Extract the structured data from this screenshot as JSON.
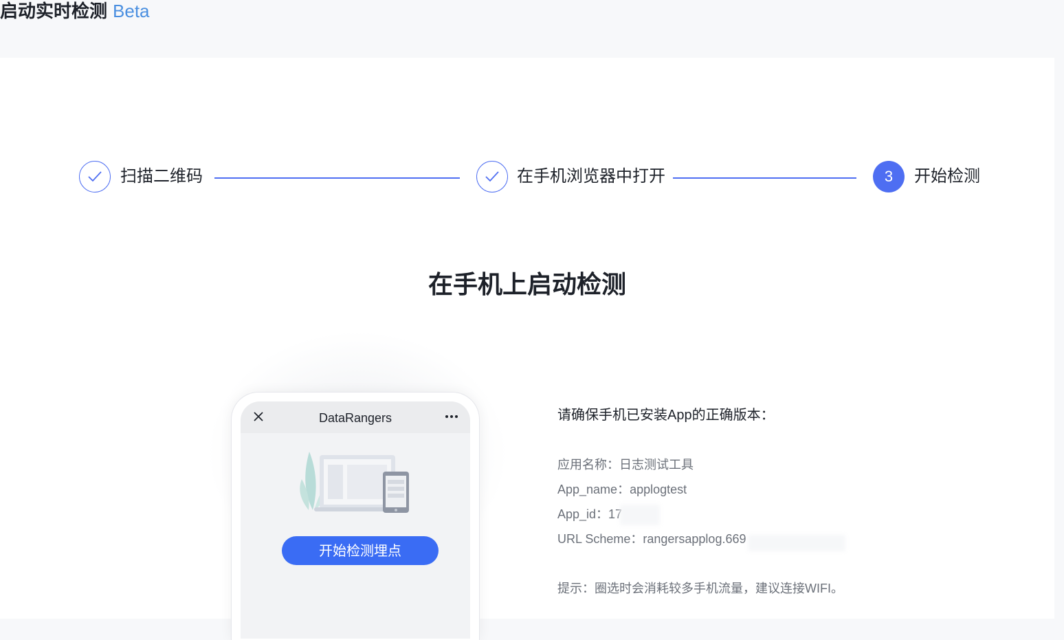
{
  "header": {
    "title": "启动实时检测",
    "badge": "Beta"
  },
  "steps": [
    {
      "label": "扫描二维码",
      "status": "done",
      "icon": "check-icon"
    },
    {
      "label": "在手机浏览器中打开",
      "status": "done",
      "icon": "check-icon"
    },
    {
      "label": "开始检测",
      "status": "active",
      "number": "3"
    }
  ],
  "main": {
    "heading": "在手机上启动检测"
  },
  "phone": {
    "title": "DataRangers",
    "close_icon": "close-icon",
    "more_icon": "more-icon",
    "button_label": "开始检测埋点"
  },
  "info": {
    "heading": "请确保手机已安装App的正确版本：",
    "app_name_cn": "应用名称：日志测试工具",
    "app_name": "App_name：applogtest",
    "app_id": "App_id：17",
    "url_scheme": "URL Scheme：rangersapplog.669",
    "tip": "提示：圈选时会消耗较多手机流量，建议连接WIFI。"
  },
  "colors": {
    "accent": "#4e6ef2",
    "button": "#3a6cf4",
    "beta": "#4a8fe0"
  }
}
